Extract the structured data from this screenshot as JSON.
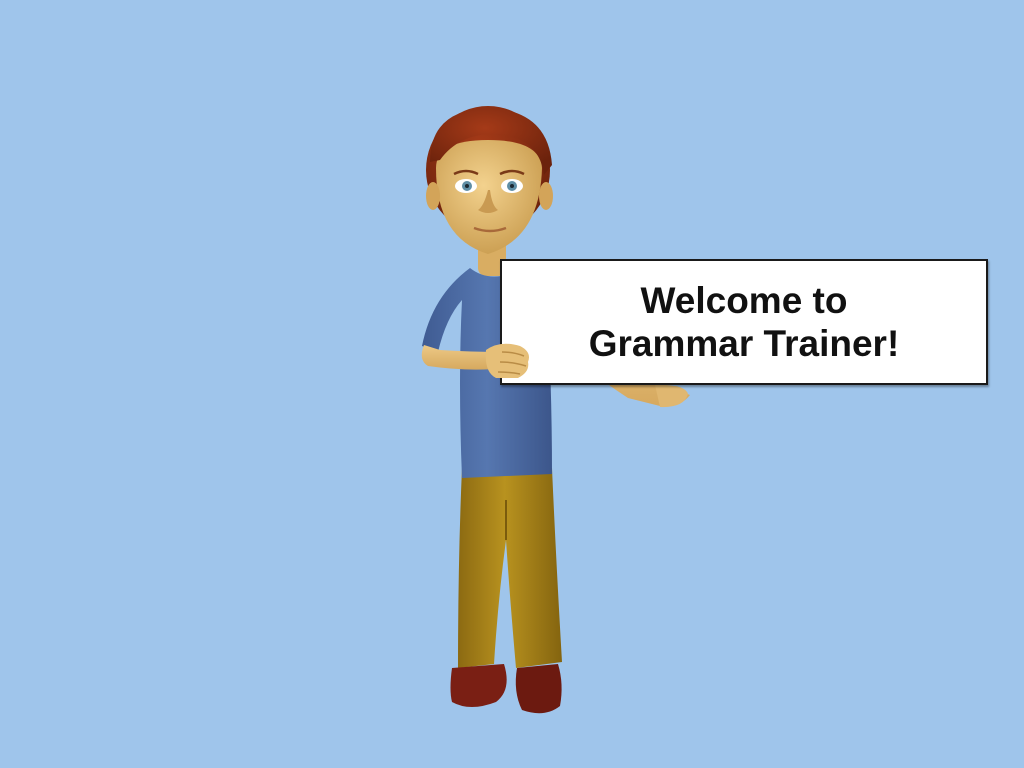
{
  "scene": {
    "background_color": "#9fc5eb"
  },
  "character": {
    "name": "cartoon-boy-character",
    "hair_color": "#8a2e14",
    "skin_color": "#e8c27a",
    "shirt_color": "#4f6fa8",
    "pants_color": "#b08a1e",
    "shoe_color": "#7a1f14"
  },
  "sign": {
    "line1": "Welcome to",
    "line2": "Grammar Trainer!"
  }
}
